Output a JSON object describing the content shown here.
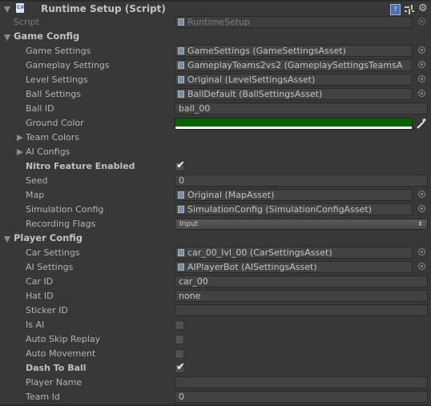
{
  "component": {
    "title": "Runtime Setup (Script)",
    "script_label": "Script",
    "script_value": "RuntimeSetup",
    "icons": [
      "csharp-script-icon",
      "help-icon",
      "presets-icon",
      "gear-icon"
    ]
  },
  "game_config": {
    "label": "Game Config",
    "fields": {
      "game_settings": {
        "label": "Game Settings",
        "value": "GameSettings (GameSettingsAsset)"
      },
      "gameplay_settings": {
        "label": "Gameplay Settings",
        "value": "GameplayTeams2vs2 (GameplaySettingsTeamsA"
      },
      "level_settings": {
        "label": "Level Settings",
        "value": "Original (LevelSettingsAsset)"
      },
      "ball_settings": {
        "label": "Ball Settings",
        "value": "BallDefault (BallSettingsAsset)"
      },
      "ball_id": {
        "label": "Ball ID",
        "value": "ball_00"
      },
      "ground_color": {
        "label": "Ground Color",
        "value": "#006400",
        "alpha": 1
      },
      "team_colors": {
        "label": "Team Colors",
        "expanded": false
      },
      "ai_configs": {
        "label": "AI Configs",
        "expanded": false
      },
      "nitro": {
        "label": "Nitro Feature Enabled",
        "checked": true
      },
      "seed": {
        "label": "Seed",
        "value": "0"
      },
      "map": {
        "label": "Map",
        "value": "Original (MapAsset)"
      },
      "simulation_config": {
        "label": "Simulation Config",
        "value": "SimulationConfig (SimulationConfigAsset)"
      },
      "recording_flags": {
        "label": "Recording Flags",
        "value": "Input",
        "arrows": "⬍"
      }
    }
  },
  "player_config": {
    "label": "Player Config",
    "fields": {
      "car_settings": {
        "label": "Car Settings",
        "value": "car_00_lvl_00 (CarSettingsAsset)"
      },
      "ai_settings": {
        "label": "AI Settings",
        "value": "AIPlayerBot (AISettingsAsset)"
      },
      "car_id": {
        "label": "Car ID",
        "value": "car_00"
      },
      "hat_id": {
        "label": "Hat ID",
        "value": "none"
      },
      "sticker_id": {
        "label": "Sticker ID",
        "value": ""
      },
      "is_ai": {
        "label": "Is AI",
        "checked": false
      },
      "auto_skip_replay": {
        "label": "Auto Skip Replay",
        "checked": false
      },
      "auto_movement": {
        "label": "Auto Movement",
        "checked": false
      },
      "dash_to_ball": {
        "label": "Dash To Ball",
        "checked": true
      },
      "player_name": {
        "label": "Player Name",
        "value": ""
      },
      "team_id": {
        "label": "Team Id",
        "value": "0"
      }
    }
  },
  "glyphs": {
    "tick": "✔",
    "gear": "⚙",
    "help": "?",
    "cs": "C#"
  }
}
